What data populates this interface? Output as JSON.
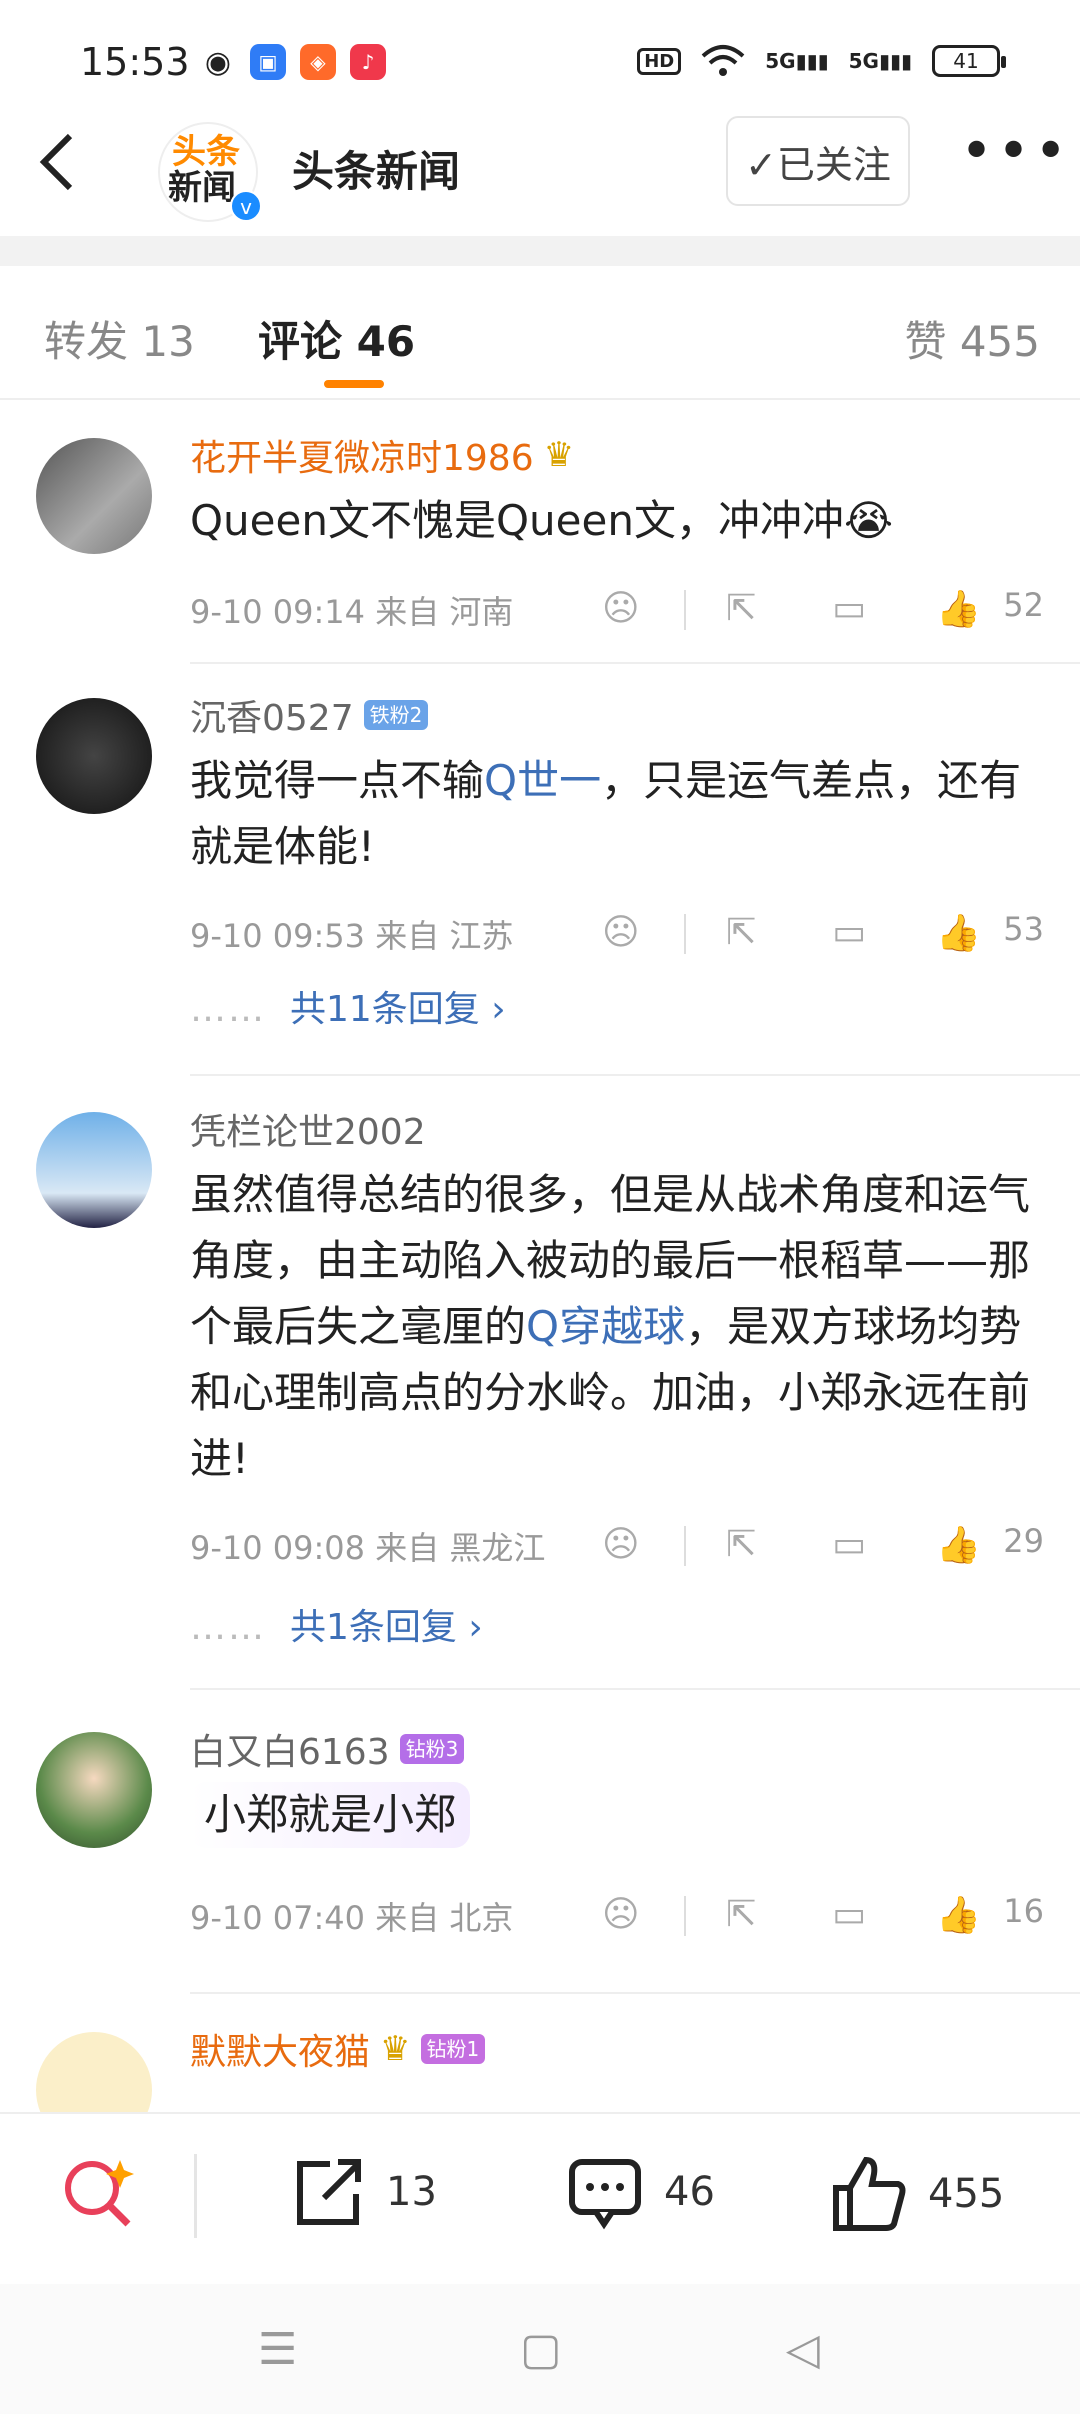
{
  "status_bar": {
    "time": "15:53",
    "hd_label": "HD",
    "signal1": "5G",
    "signal2": "5G",
    "battery": "41"
  },
  "header": {
    "logo_line1": "头条",
    "logo_line2": "新闻",
    "title": "头条新闻",
    "follow_label": "✓已关注",
    "more_label": "•••"
  },
  "tabs": {
    "repost": "转发 13",
    "comments": "评论 46",
    "likes": "赞 455"
  },
  "comments": [
    {
      "user": "花开半夏微凉时1986",
      "name_color": "#e86b0f",
      "badge": "",
      "text_parts": [
        "Queen文不愧是Queen文，冲冲冲😭"
      ],
      "time_loc": "9-10 09:14  来自 河南",
      "likes": "52"
    },
    {
      "user": "沉香0527",
      "name_color": "#666666",
      "badge": "铁粉2",
      "text_pre": "我觉得一点不输",
      "text_link": "Q世一",
      "text_post": "，只是运气差点，还有就是体能!",
      "time_loc": "9-10 09:53  来自 江苏",
      "likes": "53",
      "replies": "共11条回复 ›"
    },
    {
      "user": "凭栏论世2002",
      "name_color": "#666666",
      "badge": "",
      "text_pre": "虽然值得总结的很多，但是从战术角度和运气角度，由主动陷入被动的最后一根稻草——那个最后失之毫厘的",
      "text_link": "Q穿越球",
      "text_post": "，是双方球场均势和心理制高点的分水岭。加油，小郑永远在前进!",
      "time_loc": "9-10 09:08  来自 黑龙江",
      "likes": "29",
      "replies": "共1条回复 ›"
    },
    {
      "user": "白又白6163",
      "name_color": "#666666",
      "badge": "钻粉3",
      "text": "小郑就是小郑",
      "time_loc": "9-10 07:40  来自 北京",
      "likes": "16"
    },
    {
      "user": "默默大夜猫",
      "name_color": "#e86b0f",
      "badge": "钻粉1"
    }
  ],
  "reply_dots": "……",
  "bottom_bar": {
    "repost_count": "13",
    "comment_count": "46",
    "like_count": "455"
  },
  "colors": {
    "accent": "#ff8200",
    "link": "#3d6fb7"
  }
}
